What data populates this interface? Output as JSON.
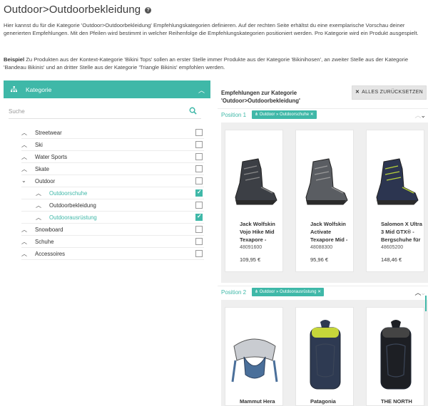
{
  "page": {
    "title": "Outdoor>Outdoorbekleidung",
    "intro": "Hier kannst du für die Kategorie 'Outdoor>Outdoorbekleidung' Empfehlungskategorien definieren. Auf der rechten Seite erhältst du eine exemplarische Vorschau deiner generierten Empfehlungen. Mit den Pfeilen wird bestimmt in welcher Reihenfolge die Empfehlungskategorien positioniert werden. Pro Kategorie wird ein Produkt ausgespielt.",
    "example_label": "Beispiel",
    "example_text": " Zu Produkten aus der Kontext-Kategorie 'Bikini Tops' sollen an erster Stelle immer Produkte aus der Kategorie 'Bikinihosen', an zweiter Stelle aus der Kategorie 'Bandeau Bikinis' und an dritter Stelle aus der Kategorie 'Triangle Bikinis' empfohlen werden."
  },
  "category_panel": {
    "header": "Kategorie",
    "search_placeholder": "Suche",
    "items": [
      {
        "label": "Streetwear",
        "level": 0,
        "expanded": false,
        "checked": false
      },
      {
        "label": "Ski",
        "level": 0,
        "expanded": false,
        "checked": false
      },
      {
        "label": "Water Sports",
        "level": 0,
        "expanded": false,
        "checked": false
      },
      {
        "label": "Skate",
        "level": 0,
        "expanded": false,
        "checked": false
      },
      {
        "label": "Outdoor",
        "level": 0,
        "expanded": true,
        "checked": false
      },
      {
        "label": "Outdoorschuhe",
        "level": 1,
        "expanded": false,
        "checked": true
      },
      {
        "label": "Outdoorbekleidung",
        "level": 1,
        "expanded": false,
        "checked": false
      },
      {
        "label": "Outdoorausrüstung",
        "level": 1,
        "expanded": false,
        "checked": true
      },
      {
        "label": "Snowboard",
        "level": 0,
        "expanded": false,
        "checked": false
      },
      {
        "label": "Schuhe",
        "level": 0,
        "expanded": false,
        "checked": false
      },
      {
        "label": "Accessoires",
        "level": 0,
        "expanded": false,
        "checked": false
      }
    ]
  },
  "recommendations": {
    "title": "Empfehlungen zur Kategorie 'Outdoor>Outdoorbekleidung'",
    "reset_label": "ALLES ZURÜCKSETZEN",
    "positions": [
      {
        "label": "Position 1",
        "tag": "Outdoor » Outdoorschuhe",
        "products": [
          {
            "name": "Jack Wolfskin Vojo Hike Mid Texapore -",
            "sku": "48091600",
            "price": "109,95 €"
          },
          {
            "name": "Jack Wolfskin Activate Texapore Mid -",
            "sku": "48088300",
            "price": "95,96 €"
          },
          {
            "name": "Salomon X Ultra 3 Mid GTX® - Bergschuhe für",
            "sku": "48605200",
            "price": "148,46 €"
          }
        ]
      },
      {
        "label": "Position 2",
        "tag": "Outdoor » Outdoorausrüstung",
        "products": [
          {
            "name": "Mammut Hera Pro",
            "sku": "",
            "price": ""
          },
          {
            "name": "Patagonia Linked",
            "sku": "",
            "price": ""
          },
          {
            "name": "THE NORTH FACE",
            "sku": "",
            "price": ""
          }
        ]
      }
    ]
  },
  "colors": {
    "accent": "#3fb8a8"
  }
}
